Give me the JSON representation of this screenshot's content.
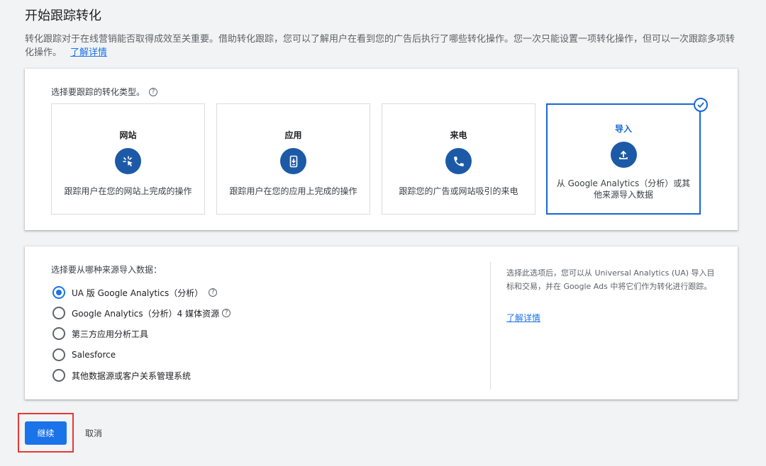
{
  "page": {
    "title": "开始跟踪转化",
    "intro": "转化跟踪对于在线营销能否取得成效至关重要。借助转化跟踪，您可以了解用户在看到您的广告后执行了哪些转化操作。您一次只能设置一项转化操作，但可以一次跟踪多项转化操作。",
    "learn_more": "了解详情"
  },
  "types": {
    "label": "选择要跟踪的转化类型。",
    "tiles": [
      {
        "title": "网站",
        "desc": "跟踪用户在您的网站上完成的操作",
        "icon": "cursor-click-icon"
      },
      {
        "title": "应用",
        "desc": "跟踪用户在您的应用上完成的操作",
        "icon": "mobile-download-icon"
      },
      {
        "title": "来电",
        "desc": "跟踪您的广告或网站吸引的来电",
        "icon": "phone-icon"
      },
      {
        "title": "导入",
        "desc": "从 Google Analytics（分析）或其他来源导入数据",
        "icon": "upload-icon",
        "selected": true
      }
    ]
  },
  "source": {
    "label": "选择要从哪种来源导入数据：",
    "options": [
      {
        "label": "UA 版 Google Analytics（分析）",
        "checked": true,
        "help": true
      },
      {
        "label": "Google Analytics（分析）4 媒体资源",
        "checked": false,
        "help": true
      },
      {
        "label": "第三方应用分析工具",
        "checked": false,
        "help": false
      },
      {
        "label": "Salesforce",
        "checked": false,
        "help": false
      },
      {
        "label": "其他数据源或客户关系管理系统",
        "checked": false,
        "help": false
      }
    ],
    "note": "选择此选项后，您可以从 Universal Analytics (UA) 导入目标和交易，并在 Google Ads 中将它们作为转化进行跟踪。",
    "note_link": "了解详情"
  },
  "actions": {
    "continue": "继续",
    "cancel": "取消"
  },
  "colors": {
    "accent": "#1a73e8",
    "icon_bg": "#1c5aa7",
    "highlight": "#e53935"
  }
}
